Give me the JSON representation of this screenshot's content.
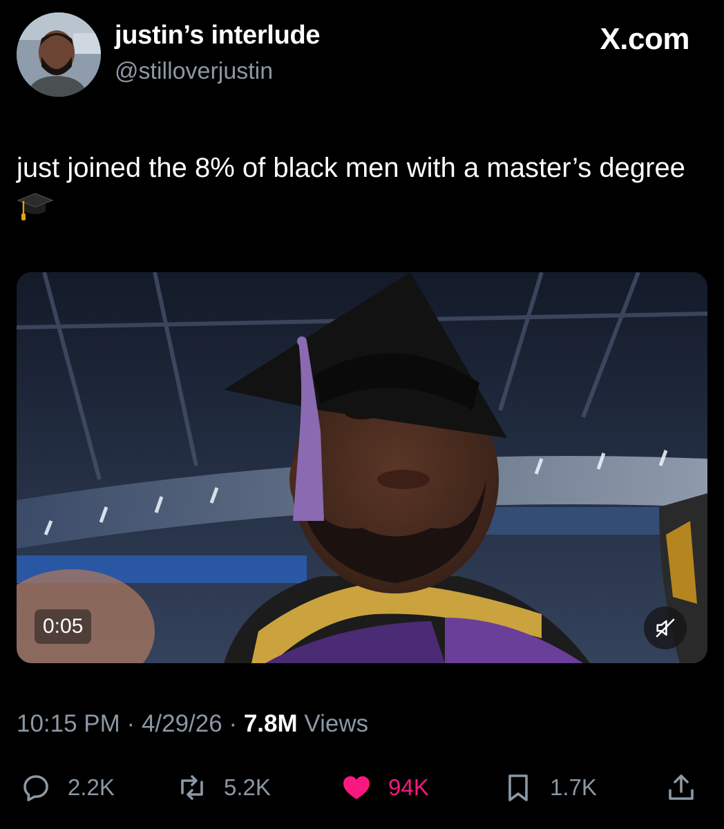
{
  "author": {
    "display_name": "justin’s interlude",
    "handle": "@stilloverjustin"
  },
  "site_label": "X.com",
  "tweet": {
    "text": "just joined the 8% of black men with a master’s degree",
    "emoji_icon": "graduation-cap-icon"
  },
  "media": {
    "duration": "0:05",
    "muted": true
  },
  "meta": {
    "time": "10:15 PM",
    "separator": "·",
    "date": "4/29/26",
    "views_count": "7.8M",
    "views_label": "Views"
  },
  "actions": {
    "replies": "2.2K",
    "reposts": "5.2K",
    "likes": "94K",
    "bookmarks": "1.7K"
  },
  "colors": {
    "background": "#000000",
    "text_primary": "#ffffff",
    "text_secondary": "#8b98a5",
    "like_active": "#f91880"
  }
}
